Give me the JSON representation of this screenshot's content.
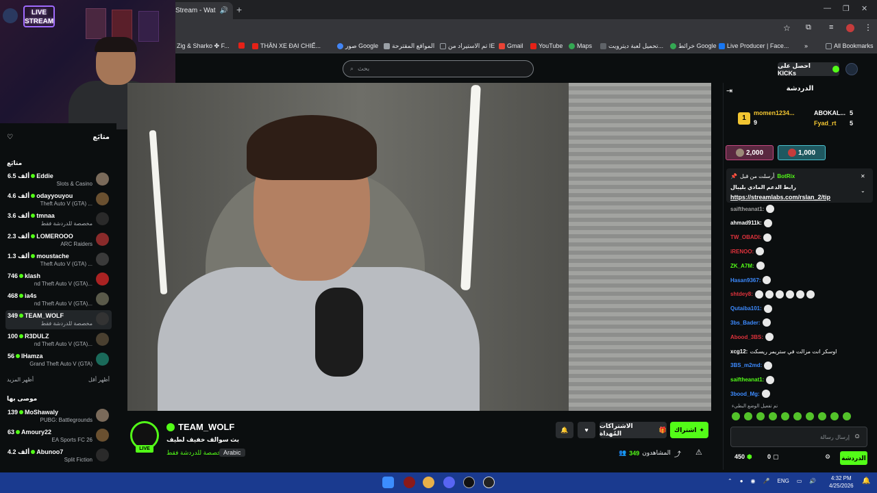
{
  "browser": {
    "tab_title": "Stream - Wat",
    "bookmarks": [
      "Zig & Sharko ✤ F...",
      "THĂN XE ĐẠI CHIẾ...",
      "صور Google",
      "المواقع المقترحة",
      "تم الاستيراد من IE",
      "Gmail",
      "YouTube",
      "Maps",
      "تحميل لعبة ديترويت...",
      "خرائط Google",
      "Live Producer | Face...",
      "All Bookmarks"
    ]
  },
  "nav": {
    "search_placeholder": "بحث",
    "kicks_label": "احصل على KICKs"
  },
  "cam": {
    "live_label": "LIVE\nSTREAM"
  },
  "sidebar": {
    "following_title": "متابَع",
    "following_section": "متابَع",
    "channels": [
      {
        "count": "6.5 ألف",
        "name": "Eddie",
        "game": "Slots & Casino"
      },
      {
        "count": "4.6 ألف",
        "name": "odayyouyou",
        "game": "Theft Auto V (GTA) ..."
      },
      {
        "count": "3.6 ألف",
        "name": "tmnaa",
        "game": "مخصصة للدردشة فقط"
      },
      {
        "count": "2.3 ألف",
        "name": "LOMEROOO",
        "game": "ARC Raiders"
      },
      {
        "count": "1.3 ألف",
        "name": "moustache",
        "game": "Theft Auto V (GTA) ..."
      },
      {
        "count": "746",
        "name": "klash",
        "game": "nd Theft Auto V (GTA)..."
      },
      {
        "count": "468",
        "name": "ia4s",
        "game": "nd Theft Auto V (GTA)..."
      },
      {
        "count": "349",
        "name": "TEAM_WOLF",
        "game": "مخصصة للدردشة فقط"
      },
      {
        "count": "100",
        "name": "R3DULZ",
        "game": "nd Theft Auto V (GTA)..."
      },
      {
        "count": "56",
        "name": "IHamza",
        "game": "Grand Theft Auto V (GTA)"
      }
    ],
    "show_more": "أظهر المزيد",
    "show_less": "أظهر أقل",
    "recommended_title": "موصى بها",
    "recommended": [
      {
        "count": "139",
        "name": "MoShawaly",
        "game": "PUBG: Battlegrounds"
      },
      {
        "count": "63",
        "name": "Amoury22",
        "game": "EA Sports FC 26"
      },
      {
        "count": "4.2 ألف",
        "name": "Abunoo7",
        "game": "Split Fiction"
      }
    ]
  },
  "stream": {
    "channel": "TEAM_WOLF",
    "title": "بث سوالف خفيف لطيف",
    "category": "مخصصة للدردشة فقط",
    "language": "Arabic",
    "live": "LIVE",
    "subscribe": "اشتراك",
    "gift_subs": "الاشتراكات المُهداة",
    "viewers_label": "المشاهدون",
    "viewers": "349"
  },
  "chat": {
    "title": "الدردشة",
    "leaderboard": [
      {
        "name": "momen1234...",
        "value": "9"
      },
      {
        "name": "ABOKAL...",
        "value": "5"
      },
      {
        "name": "Fyad_rt",
        "value": "5"
      }
    ],
    "kicks_1": "2,000",
    "kicks_2": "1,000",
    "pinned_header": "أرسلت من قبل",
    "pinned_user": "BotRix",
    "pinned_text": "رابط الدعم المادي بليبال",
    "pinned_link": "https://streamlabs.com/rslan_2/tip",
    "messages": [
      {
        "user": "saiftheanat1:",
        "color": "#a0a0a0",
        "text": ""
      },
      {
        "user": "ahmad911k:",
        "color": "#ffffff",
        "text": ""
      },
      {
        "user": "TW_OBADI:",
        "color": "#e0323c",
        "text": ""
      },
      {
        "user": "iRENOO:",
        "color": "#e0323c",
        "text": ""
      },
      {
        "user": "ZK_A7M:",
        "color": "#53fc18",
        "text": ""
      },
      {
        "user": "Hasan9367:",
        "color": "#3d8bff",
        "text": ""
      },
      {
        "user": "shtdey8:",
        "color": "#e0323c",
        "text": ""
      },
      {
        "user": "Qutaiba101:",
        "color": "#3d8bff",
        "text": ""
      },
      {
        "user": "3bs_Bader:",
        "color": "#3d8bff",
        "text": ""
      },
      {
        "user": "Abood_3BS:",
        "color": "#e0323c",
        "text": ""
      },
      {
        "user": "xcg12:",
        "color": "#ffffff",
        "text": "اوسكر انت مزالت في ستريمر ريسكت"
      },
      {
        "user": "3BS_m2md:",
        "color": "#3d8bff",
        "text": ""
      },
      {
        "user": "saiftheanat1:",
        "color": "#53fc18",
        "text": ""
      },
      {
        "user": "3bood_Mg:",
        "color": "#3d8bff",
        "text": ""
      }
    ],
    "slow_mode": "تم تفعيل الوضع البطيء",
    "input_placeholder": "إرسال رسالة",
    "points": "450",
    "kicks_balance": "0",
    "chat_button": "الدردشة"
  },
  "taskbar": {
    "lang": "ENG",
    "time": "4:32 PM",
    "date": "4/25/2026"
  }
}
